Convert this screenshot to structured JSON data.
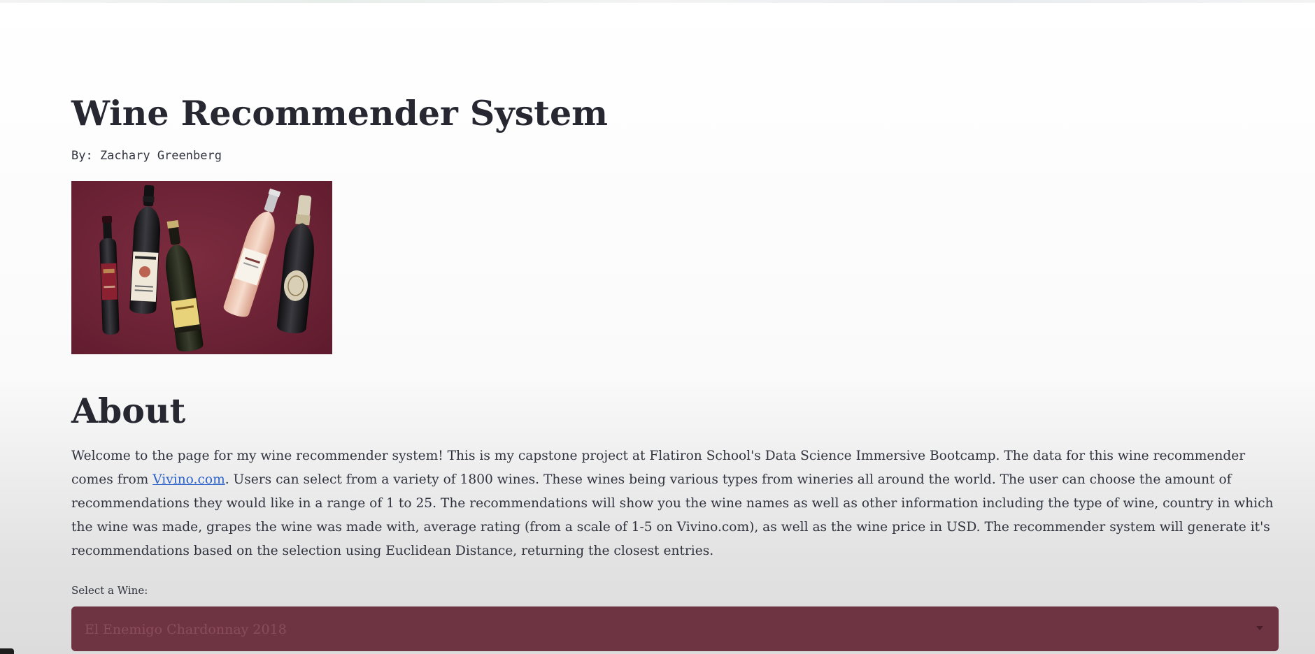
{
  "page": {
    "title": "Wine Recommender System",
    "byline": "By: Zachary Greenberg"
  },
  "hero_image": {
    "subject": "five wine bottles on a burgundy background",
    "background_color": "#6d2336"
  },
  "about": {
    "heading": "About",
    "text_before_link": "Welcome to the page for my wine recommender system! This is my capstone project at Flatiron School's Data Science Immersive Bootcamp. The data for this wine recommender comes from ",
    "link_text": "Vivino.com",
    "text_after_link": ". Users can select from a variety of 1800 wines. These wines being various types from wineries all around the world. The user can choose the amount of recommendations they would like in a range of 1 to 25. The recommendations will show you the wine names as well as other information including the type of wine, country in which the wine was made, grapes the wine was made with, average rating (from a scale of 1-5 on Vivino.com), as well as the wine price in USD. The recommender system will generate it's recommendations based on the selection using Euclidean Distance, returning the closest entries."
  },
  "wine_select": {
    "label": "Select a Wine:",
    "selected_value": "El Enemigo Chardonnay 2018",
    "icon": "chevron-down-icon",
    "background_color": "#6f3442"
  },
  "colors": {
    "text": "#262730",
    "link": "#2a62c9",
    "accent": "#6f3442"
  }
}
